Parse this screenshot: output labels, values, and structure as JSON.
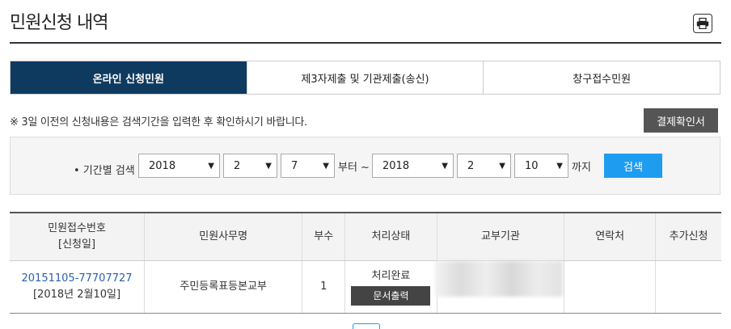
{
  "header": {
    "title": "민원신청 내역",
    "print_icon": "printer-icon"
  },
  "tabs": [
    {
      "label": "온라인 신청민원",
      "active": true
    },
    {
      "label": "제3자제출 및 기관제출(송신)",
      "active": false
    },
    {
      "label": "창구접수민원",
      "active": false
    }
  ],
  "notice": "※ 3일 이전의 신청내용은 검색기간을 입력한 후 확인하시기 바랍니다.",
  "confirm_button": "결제확인서",
  "search": {
    "label": "• 기간별 검색",
    "from_year": "2018",
    "from_month": "2",
    "from_day": "7",
    "from_suffix": "부터 ~",
    "to_year": "2018",
    "to_month": "2",
    "to_day": "10",
    "to_suffix": "까지",
    "button": "검색"
  },
  "table": {
    "headers": {
      "receipt_no": "민원접수번호",
      "receipt_sub": "[신청일]",
      "name": "민원사무명",
      "copies": "부수",
      "status": "처리상태",
      "agency": "교부기관",
      "contact": "연락처",
      "extra": "추가신청"
    },
    "rows": [
      {
        "receipt_no": "20151105-77707727",
        "date": "[2018년 2월10일]",
        "name": "주민등록표등본교부",
        "copies": "1",
        "status": "처리완료",
        "status_button": "문서출력"
      }
    ]
  },
  "colors": {
    "tab_active": "#0f3a60",
    "search_button": "#1e9df0",
    "dark_button": "#555555"
  }
}
